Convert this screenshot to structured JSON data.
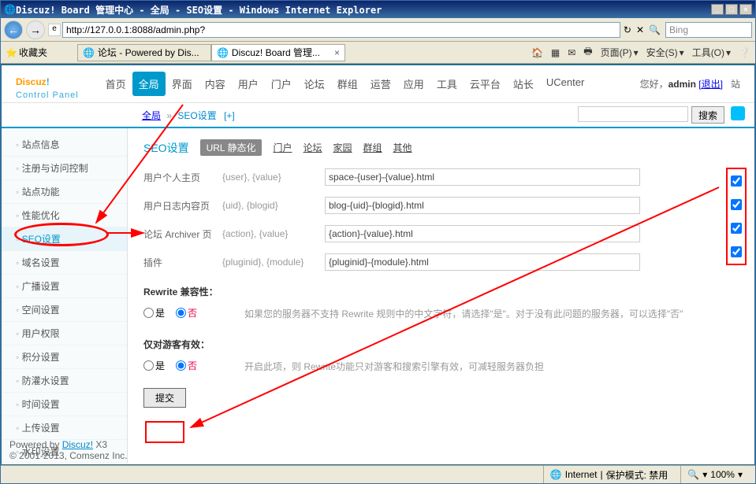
{
  "window": {
    "title": "Discuz! Board 管理中心 - 全局 - SEO设置 - Windows Internet Explorer"
  },
  "address": {
    "url": "http://127.0.0.1:8088/admin.php?"
  },
  "browser_search": {
    "placeholder": "Bing"
  },
  "fav_label": "收藏夹",
  "tabs": [
    {
      "label": "论坛 - Powered by Dis..."
    },
    {
      "label": "Discuz! Board 管理..."
    }
  ],
  "ie_tools": {
    "home": "🏠",
    "rss": "▦",
    "mail": "✉",
    "print": "🖶",
    "page": "页面(P)",
    "safety": "安全(S)",
    "tools": "工具(O)",
    "help": "❔"
  },
  "logo": {
    "text": "Discuz",
    "sub": "Control Panel"
  },
  "header_right": {
    "greet": "您好，",
    "user": "admin",
    "logout": "[退出]",
    "station": "站"
  },
  "topnav": [
    "首页",
    "全局",
    "界面",
    "内容",
    "用户",
    "门户",
    "论坛",
    "群组",
    "运营",
    "应用",
    "工具",
    "云平台",
    "站长",
    "UCenter"
  ],
  "topnav_active": 1,
  "breadcrumb": {
    "a": "全局",
    "b": "SEO设置",
    "plus": "[+]"
  },
  "search_btn": "搜索",
  "sidebar": [
    "站点信息",
    "注册与访问控制",
    "站点功能",
    "性能优化",
    "SEO设置",
    "域名设置",
    "广播设置",
    "空间设置",
    "用户权限",
    "积分设置",
    "防灌水设置",
    "时间设置",
    "上传设置",
    "水印设置"
  ],
  "sidebar_active": 4,
  "panel_title": "SEO设置",
  "panel_tag": "URL 静态化",
  "panel_tabs": [
    "门户",
    "论坛",
    "家园",
    "群组",
    "其他"
  ],
  "rows": [
    {
      "label": "用户个人主页",
      "vars": "{user}, {value}",
      "val": "space-{user}-{value}.html"
    },
    {
      "label": "用户日志内容页",
      "vars": "{uid}, {blogid}",
      "val": "blog-{uid}-{blogid}.html"
    },
    {
      "label": "论坛 Archiver 页",
      "vars": "{action}, {value}",
      "val": "{action}-{value}.html"
    },
    {
      "label": "插件",
      "vars": "{pluginid}, {module}",
      "val": "{pluginid}-{module}.html"
    }
  ],
  "compat": {
    "title": "Rewrite 兼容性：",
    "yes": "是",
    "no": "否",
    "hint": "如果您的服务器不支持 Rewrite 规则中的中文字符，请选择\"是\"。对于没有此问题的服务器，可以选择\"否\""
  },
  "guest": {
    "title": "仅对游客有效：",
    "yes": "是",
    "no": "否",
    "hint": "开启此项，则 Rewrite功能只对游客和搜索引擎有效，可减轻服务器负担"
  },
  "submit": "提交",
  "footer": {
    "l1a": "Powered by ",
    "l1b": "Discuz!",
    "l1c": " X3",
    "l2": "© 2001-2013, Comsenz Inc."
  },
  "status": {
    "internet": "Internet",
    "protect": "保护模式: 禁用",
    "zoom": "100%"
  }
}
